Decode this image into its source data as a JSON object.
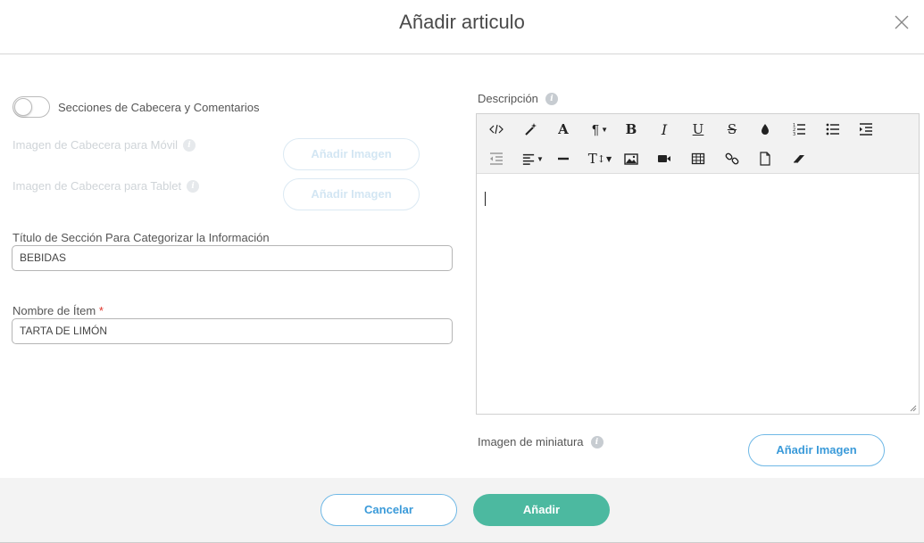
{
  "modal": {
    "title": "Añadir articulo"
  },
  "form": {
    "toggle_label": "Secciones de Cabecera y Comentarios",
    "toggle_on": false,
    "mobile_header_label": "Imagen de Cabecera para Móvil",
    "tablet_header_label": "Imagen de Cabecera para Tablet",
    "add_image_label": "Añadir Imagen",
    "section_title_label": "Título de Sección Para Categorizar la Información",
    "section_title_value": "BEBIDAS",
    "item_name_label": "Nombre de Ítem",
    "item_name_required": "*",
    "item_name_value": "TARTA DE LIMÓN",
    "description_label": "Descripción",
    "thumbnail_label": "Imagen de miniatura"
  },
  "editor": {
    "toolbar": [
      "code-view-icon",
      "magic-wand-icon",
      "font-icon",
      "paragraph-icon",
      "bold-icon",
      "italic-icon",
      "underline-icon",
      "strikethrough-icon",
      "color-drop-icon",
      "ordered-list-icon",
      "unordered-list-icon",
      "indent-icon",
      "outdent-icon",
      "align-icon",
      "horizontal-rule-icon",
      "font-size-icon",
      "image-icon",
      "video-icon",
      "table-icon",
      "link-icon",
      "file-icon",
      "eraser-icon"
    ],
    "content": ""
  },
  "footer": {
    "cancel_label": "Cancelar",
    "submit_label": "Añadir"
  },
  "colors": {
    "accent_blue": "#3a9ad9",
    "primary_green": "#4cb9a0",
    "required_red": "#e0352b"
  }
}
